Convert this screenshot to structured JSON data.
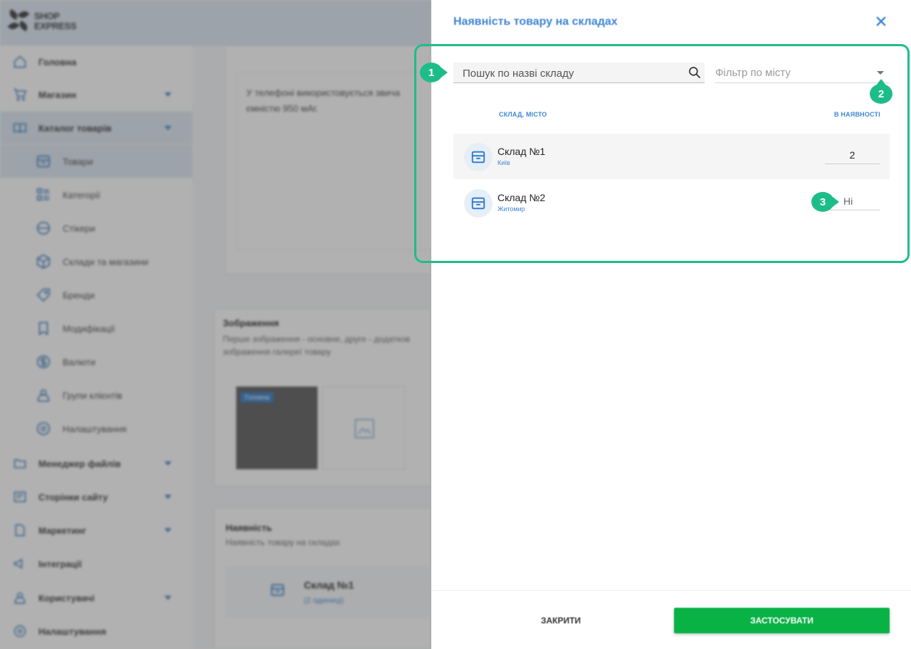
{
  "logo": {
    "line1": "SHOP",
    "line2": "EXPRESS"
  },
  "sidebar": {
    "items": [
      {
        "label": "Головна",
        "icon": "home-icon"
      },
      {
        "label": "Магазин",
        "icon": "cart-icon"
      },
      {
        "label": "Каталог товарів",
        "icon": "book-icon"
      },
      {
        "label": "Менеджер файлів",
        "icon": "folder-icon"
      },
      {
        "label": "Сторінки сайту",
        "icon": "page-icon"
      },
      {
        "label": "Маркетинг",
        "icon": "marketing-icon"
      },
      {
        "label": "Інтеграції",
        "icon": "megaphone-icon"
      },
      {
        "label": "Користувачі",
        "icon": "user-icon"
      },
      {
        "label": "Налаштування",
        "icon": "gear-icon"
      }
    ],
    "sub_items": [
      {
        "label": "Товари",
        "icon": "box-icon"
      },
      {
        "label": "Категорії",
        "icon": "list-icon"
      },
      {
        "label": "Стікери",
        "icon": "sticker-icon"
      },
      {
        "label": "Склади та магазини",
        "icon": "cube-icon"
      },
      {
        "label": "Бренди",
        "icon": "tag-icon"
      },
      {
        "label": "Модифікації",
        "icon": "bookmark-icon"
      },
      {
        "label": "Валюти",
        "icon": "dollar-icon"
      },
      {
        "label": "Групи клієнтів",
        "icon": "group-icon"
      },
      {
        "label": "Налаштування",
        "icon": "gear-icon"
      }
    ]
  },
  "background_content": {
    "description_line1": "У телефоні використовується звича",
    "description_line2": "ємністю 950 мАг.",
    "images_title": "Зображення",
    "images_sub_line1": "Перше зображення - основне, друге - додатков",
    "images_sub_line2": "зображення галереї товару",
    "image_badge": "Головна",
    "availability_title": "Наявність",
    "availability_sub": "Наявність товару на складах",
    "availability_item_name": "Склад №1",
    "availability_item_count": "(2 одиниці)"
  },
  "drawer": {
    "title": "Наявність товару на складах",
    "search_placeholder": "Пошук по назві складу",
    "city_filter_placeholder": "Фільтр по місту",
    "columns": {
      "warehouse": "СКЛАД, МІСТО",
      "in_stock": "В НАЯВНОСТІ"
    },
    "rows": [
      {
        "name": "Склад №1",
        "city": "Київ",
        "qty_value": "2",
        "qty_placeholder": ""
      },
      {
        "name": "Склад №2",
        "city": "Житомир",
        "qty_value": "",
        "qty_placeholder": "Ні"
      }
    ],
    "close_label": "ЗАКРИТИ",
    "apply_label": "ЗАСТОСУВАТИ"
  },
  "annotations": {
    "badge1": "1",
    "badge2": "2",
    "badge3": "3"
  },
  "colors": {
    "accent_blue": "#3f86d6",
    "highlight_green": "#1dbd89",
    "apply_green": "#08b245"
  }
}
